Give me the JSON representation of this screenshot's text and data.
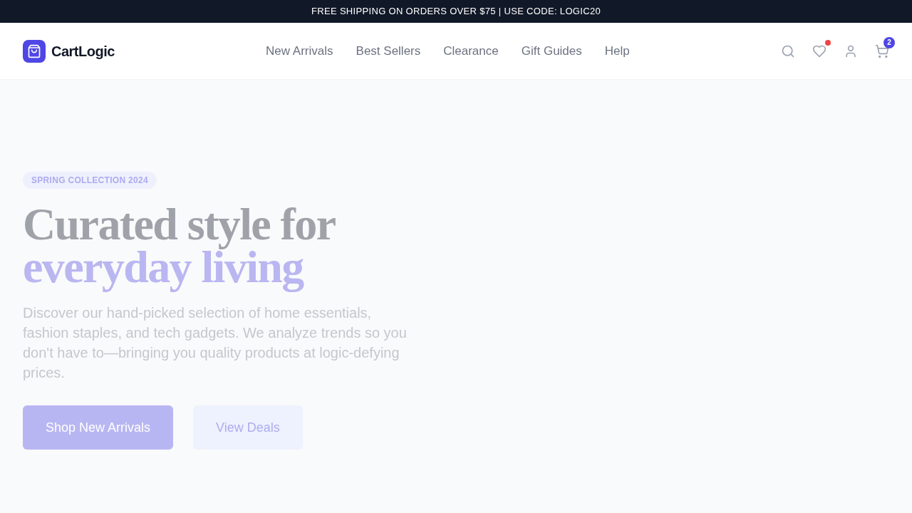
{
  "announcement_bar": {
    "text": "FREE SHIPPING ON ORDERS OVER $75 | USE CODE: LOGIC20"
  },
  "header": {
    "logo": {
      "text": "CartLogic"
    },
    "nav": [
      {
        "label": "New Arrivals"
      },
      {
        "label": "Best Sellers"
      },
      {
        "label": "Clearance"
      },
      {
        "label": "Gift Guides"
      },
      {
        "label": "Help"
      }
    ],
    "actions": [
      {
        "kind": "search"
      },
      {
        "kind": "wishlist",
        "notification_dot": true
      },
      {
        "kind": "account"
      },
      {
        "kind": "cart",
        "badge": "2"
      }
    ]
  },
  "hero": {
    "badge": "SPRING COLLECTION 2024",
    "title": "Curated style for",
    "title_accent": "everyday living",
    "description": "Discover our hand-picked selection of home essentials, fashion staples, and tech gadgets. We analyze trends so you don't have to—bringing you quality products at logic-defying prices.",
    "buttons": [
      {
        "label": "Shop New Arrivals",
        "kind": "primary"
      },
      {
        "label": "View Deals",
        "kind": "secondary"
      }
    ]
  }
}
